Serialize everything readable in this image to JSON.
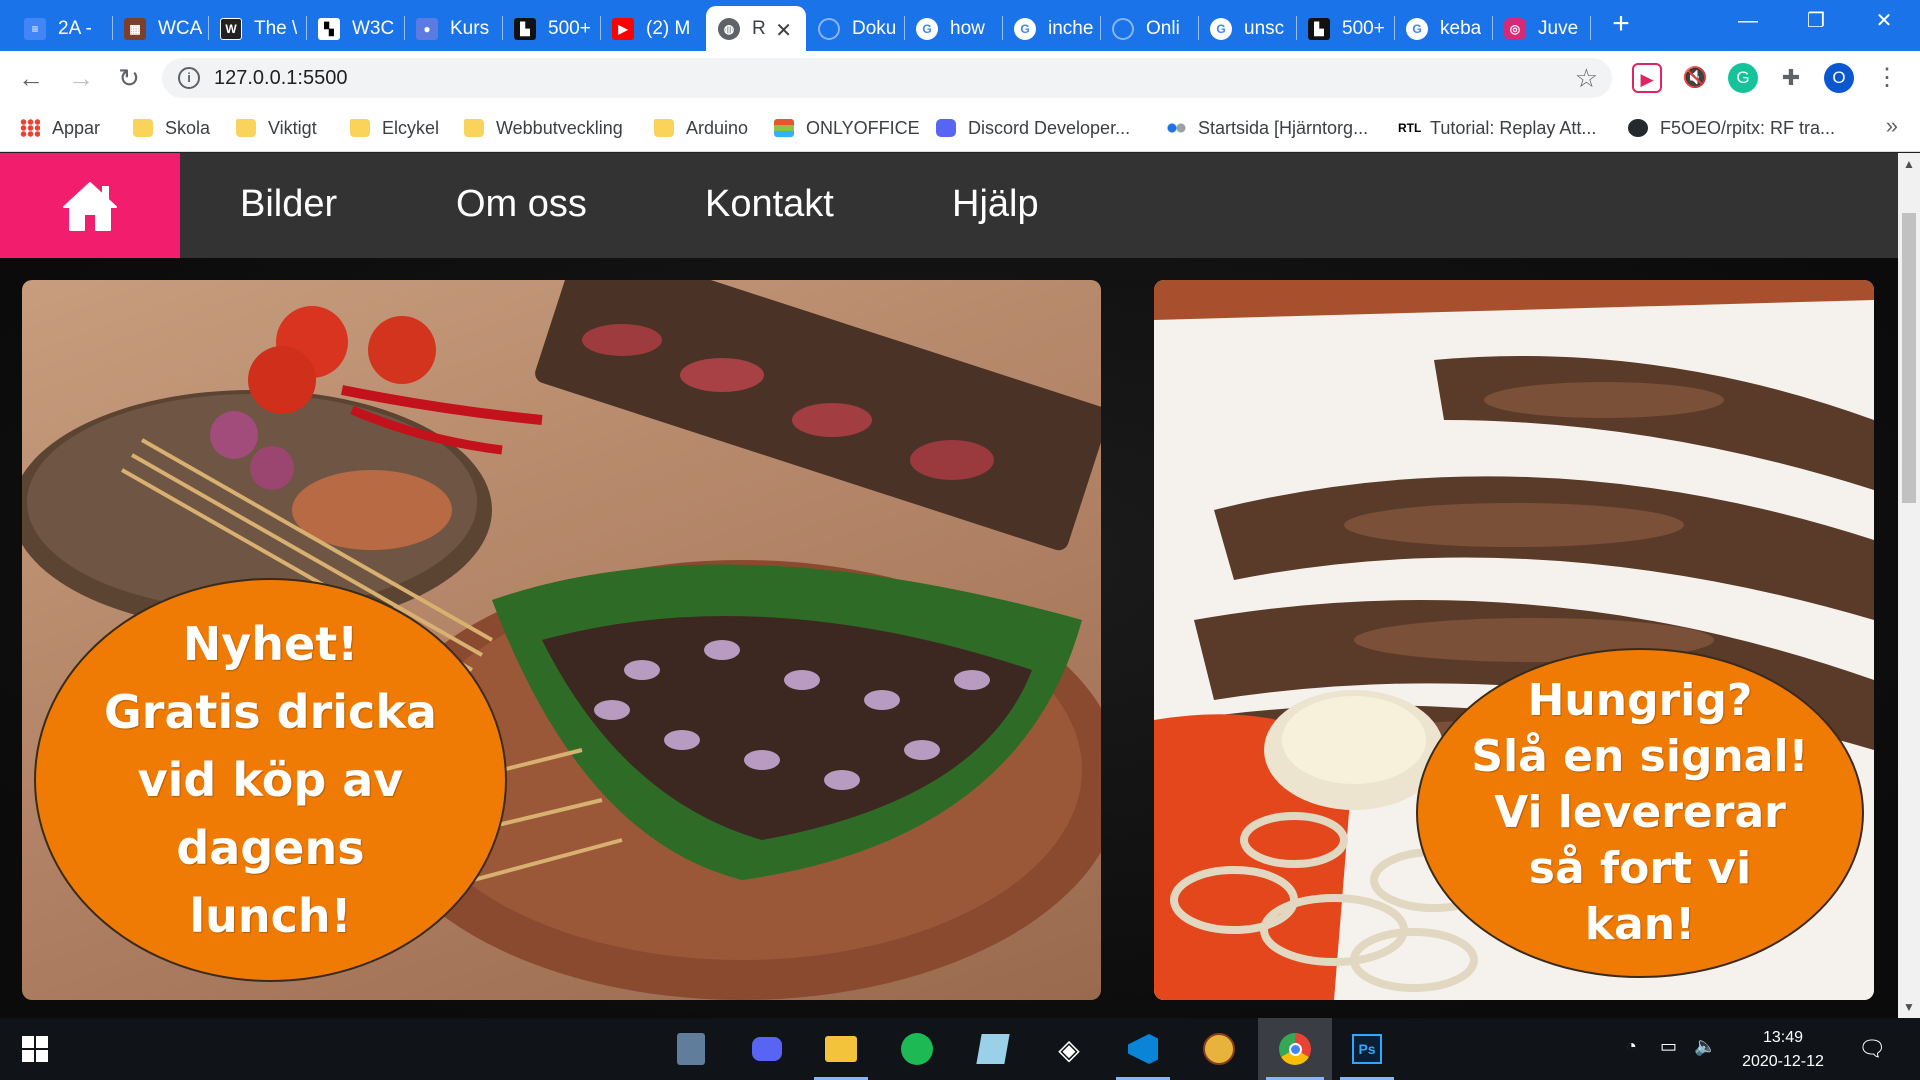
{
  "browser": {
    "tabs": [
      {
        "title": "2A -",
        "icon": "docs-icon",
        "color": "#4285f4"
      },
      {
        "title": "WCA",
        "icon": "wca-icon",
        "color": "#7b3f2a"
      },
      {
        "title": "The \\",
        "icon": "w3-icon",
        "color": "#222222"
      },
      {
        "title": "W3C",
        "icon": "w3c-icon",
        "color": "#111111"
      },
      {
        "title": "Kurs",
        "icon": "classroom-icon",
        "color": "#5b7be0"
      },
      {
        "title": "500+",
        "icon": "hackerrank-icon",
        "color": "#111111"
      },
      {
        "title": "(2) M",
        "icon": "youtube-icon",
        "color": "#ff0000"
      },
      {
        "title": "R",
        "icon": "globe-icon",
        "color": "#5f6368",
        "active": true
      },
      {
        "title": "Doku",
        "icon": "globe-icon",
        "color": "#1a73e8"
      },
      {
        "title": "how",
        "icon": "google-icon",
        "color": "#ffffff"
      },
      {
        "title": "inche",
        "icon": "google-icon",
        "color": "#ffffff"
      },
      {
        "title": "Onli",
        "icon": "globe-icon",
        "color": "#1a73e8"
      },
      {
        "title": "unsc",
        "icon": "google-icon",
        "color": "#ffffff"
      },
      {
        "title": "500+",
        "icon": "hackerrank-icon",
        "color": "#111111"
      },
      {
        "title": "keba",
        "icon": "google-icon",
        "color": "#ffffff"
      },
      {
        "title": "Juve",
        "icon": "instagram-icon",
        "color": "#d62976"
      }
    ],
    "new_tab": "+",
    "address": "127.0.0.1:5500",
    "bookmarks": [
      {
        "label": "Appar",
        "icon": "apps-grid-icon"
      },
      {
        "label": "Skola",
        "icon": "folder-icon"
      },
      {
        "label": "Viktigt",
        "icon": "folder-icon"
      },
      {
        "label": "Elcykel",
        "icon": "folder-icon"
      },
      {
        "label": "Webbutveckling",
        "icon": "folder-icon"
      },
      {
        "label": "Arduino",
        "icon": "folder-icon"
      },
      {
        "label": "ONLYOFFICE",
        "icon": "onlyoffice-icon"
      },
      {
        "label": "Discord Developer...",
        "icon": "discord-icon"
      },
      {
        "label": "Startsida [Hjärntorg...",
        "icon": "hjarntorget-icon"
      },
      {
        "label": "Tutorial: Replay Att...",
        "icon": "rtl-icon"
      },
      {
        "label": "F5OEO/rpitx: RF tra...",
        "icon": "github-icon"
      }
    ],
    "profile_initial": "O"
  },
  "site": {
    "nav": [
      "Bilder",
      "Om oss",
      "Kontakt",
      "Hjälp"
    ],
    "promo_left": [
      "Nyhet!",
      "Gratis dricka",
      "vid köp av",
      "dagens",
      "lunch!"
    ],
    "promo_right": [
      "Hungrig?",
      "Slå en signal!",
      "Vi levererar",
      "så fort vi",
      "kan!"
    ],
    "colors": {
      "home_tile": "#f31d6e",
      "nav_bg": "#333333",
      "promo": "#ef7b05"
    }
  },
  "taskbar": {
    "apps": [
      "calculator-icon",
      "discord-icon",
      "file-explorer-icon",
      "spotify-icon",
      "notepad-icon",
      "unity-icon",
      "vscode-icon",
      "shoes-game-icon",
      "chrome-icon",
      "photoshop-icon"
    ],
    "time": "13:49",
    "date": "2020-12-12"
  }
}
